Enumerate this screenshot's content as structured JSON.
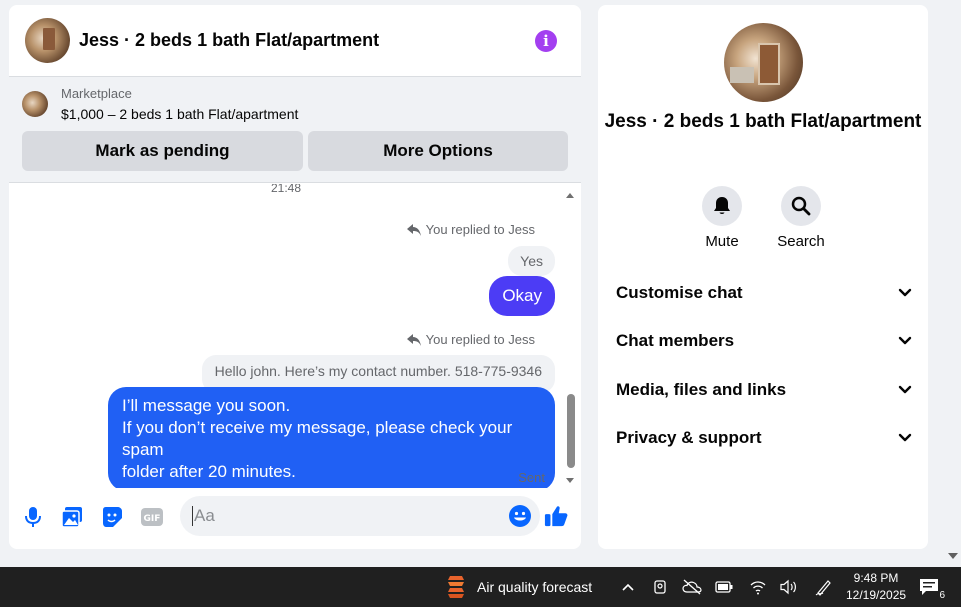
{
  "chat": {
    "title": "Jess · 2 beds 1 bath Flat/apartment",
    "marketplace_label": "Marketplace",
    "listing": "$1,000 – 2 beds 1 bath Flat/apartment",
    "buttons": {
      "pending": "Mark as pending",
      "more": "More Options"
    },
    "messages": {
      "cut_time": "21:48",
      "replied_1": "You replied to Jess",
      "quoted_1": "Yes",
      "reply_1": "Okay",
      "replied_2": "You replied to Jess",
      "quoted_2": "Hello john. Here’s my contact number. 518-775-9346",
      "reply_2_lines": [
        "I’ll message you soon.",
        "If you don’t receive my message, please check your spam",
        "folder after 20 minutes."
      ],
      "status": "Sent"
    },
    "composer": {
      "placeholder": "Aa"
    },
    "colors": {
      "accent": "#a33ff0",
      "bubble_purple": "#4c3cf5",
      "bubble_blue": "#2060f4"
    }
  },
  "info": {
    "name": "Jess · 2 beds 1 bath Flat/apartment",
    "actions": [
      {
        "label": "Mute",
        "icon": "bell-icon"
      },
      {
        "label": "Search",
        "icon": "search-icon"
      }
    ],
    "sections": [
      "Customise chat",
      "Chat members",
      "Media, files and links",
      "Privacy & support"
    ]
  },
  "taskbar": {
    "weather": "Air quality forecast",
    "time": "9:48 PM",
    "date": "12/19/2025",
    "notification_count": "6"
  }
}
